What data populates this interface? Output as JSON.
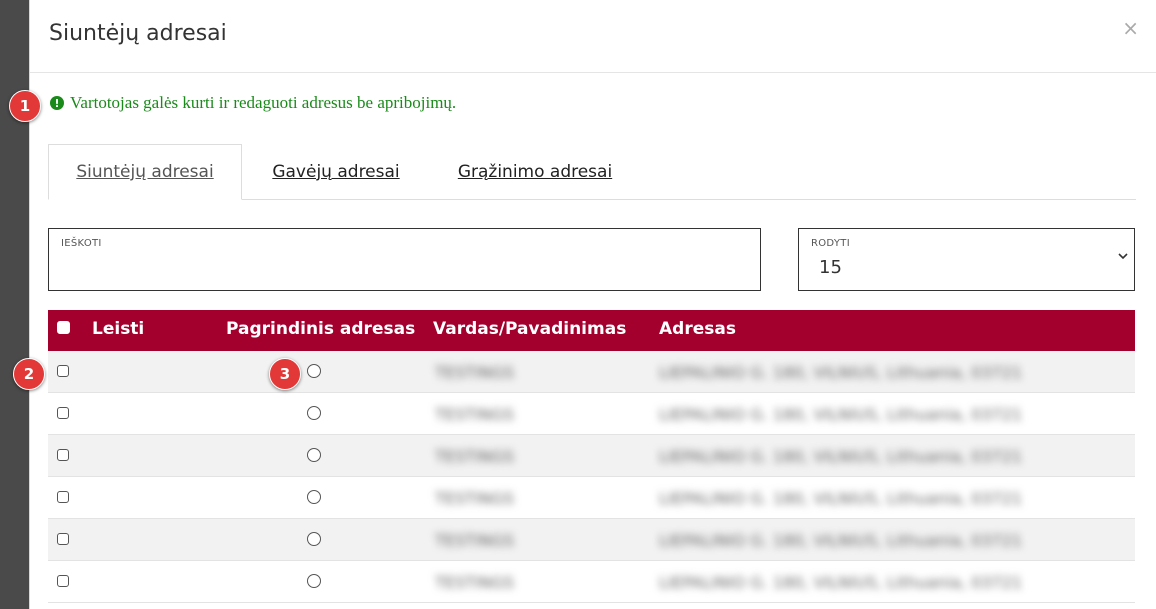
{
  "dialog": {
    "title": "Siuntėjų adresai",
    "close_label": "×"
  },
  "notice": {
    "icon": "exclamation-circle-icon",
    "icon_glyph": "!",
    "text": "Vartotojas galės kurti ir redaguoti adresus be apribojimų.",
    "color": "#1a8a1a"
  },
  "tabs": [
    {
      "label": "Siuntėjų adresai",
      "active": true
    },
    {
      "label": "Gavėjų adresai",
      "active": false
    },
    {
      "label": "Grąžinimo adresai",
      "active": false
    }
  ],
  "search": {
    "label": "IEŠKOTI",
    "value": "",
    "placeholder": ""
  },
  "show": {
    "label": "RODYTI",
    "value": "15"
  },
  "table": {
    "header_color": "#a3002e",
    "columns": [
      "Leisti",
      "Pagrindinis adresas",
      "Vardas/Pavadinimas",
      "Adresas"
    ],
    "rows": [
      {
        "name": "TESTINGS",
        "address": "LIEPALINIO G. 180, VILNIUS, Lithuania, 03721"
      },
      {
        "name": "TESTINGS",
        "address": "LIEPALINIO G. 180, VILNIUS, Lithuania, 03721"
      },
      {
        "name": "TESTINGS",
        "address": "LIEPALINIO G. 180, VILNIUS, Lithuania, 03721"
      },
      {
        "name": "TESTINGS",
        "address": "LIEPALINIO G. 180, VILNIUS, Lithuania, 03721"
      },
      {
        "name": "TESTINGS",
        "address": "LIEPALINIO G. 180, VILNIUS, Lithuania, 03721"
      },
      {
        "name": "TESTINGS",
        "address": "LIEPALINIO G. 180, VILNIUS, Lithuania, 03721"
      }
    ]
  },
  "annotations": [
    "1",
    "2",
    "3"
  ]
}
